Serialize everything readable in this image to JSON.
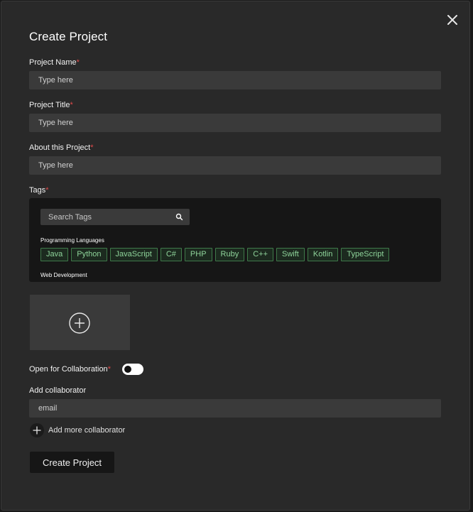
{
  "modal": {
    "title": "Create Project",
    "close_icon": "close-icon"
  },
  "fields": {
    "project_name": {
      "label": "Project Name",
      "required_mark": "*",
      "placeholder": "Type here",
      "value": ""
    },
    "project_title": {
      "label": "Project Title",
      "required_mark": "*",
      "placeholder": "Type here",
      "value": ""
    },
    "about": {
      "label": "About this Project",
      "required_mark": "*",
      "placeholder": "Type here",
      "value": ""
    }
  },
  "tags": {
    "label": "Tags",
    "required_mark": "*",
    "search_placeholder": "Search Tags",
    "search_icon": "search-icon",
    "categories": [
      {
        "name": "Programming Languages",
        "chips": [
          "Java",
          "Python",
          "JavaScript",
          "C#",
          "PHP",
          "Ruby",
          "C++",
          "Swift",
          "Kotlin",
          "TypeScript"
        ]
      },
      {
        "name": "Web Development",
        "chips": []
      }
    ]
  },
  "upload": {
    "icon": "plus-circle-icon"
  },
  "collaboration": {
    "label": "Open for Collaboration",
    "required_mark": "*",
    "toggle_on": false
  },
  "collaborator": {
    "label": "Add collaborator",
    "placeholder": "email",
    "value": "",
    "add_more_label": "Add more collaborator",
    "add_more_icon": "plus-icon"
  },
  "submit_label": "Create Project",
  "colors": {
    "background": "#292929",
    "input_bg": "#3a3a3a",
    "required": "#e04a4a",
    "chip_border": "#3f7a4a",
    "chip_text": "#8ed39a"
  }
}
